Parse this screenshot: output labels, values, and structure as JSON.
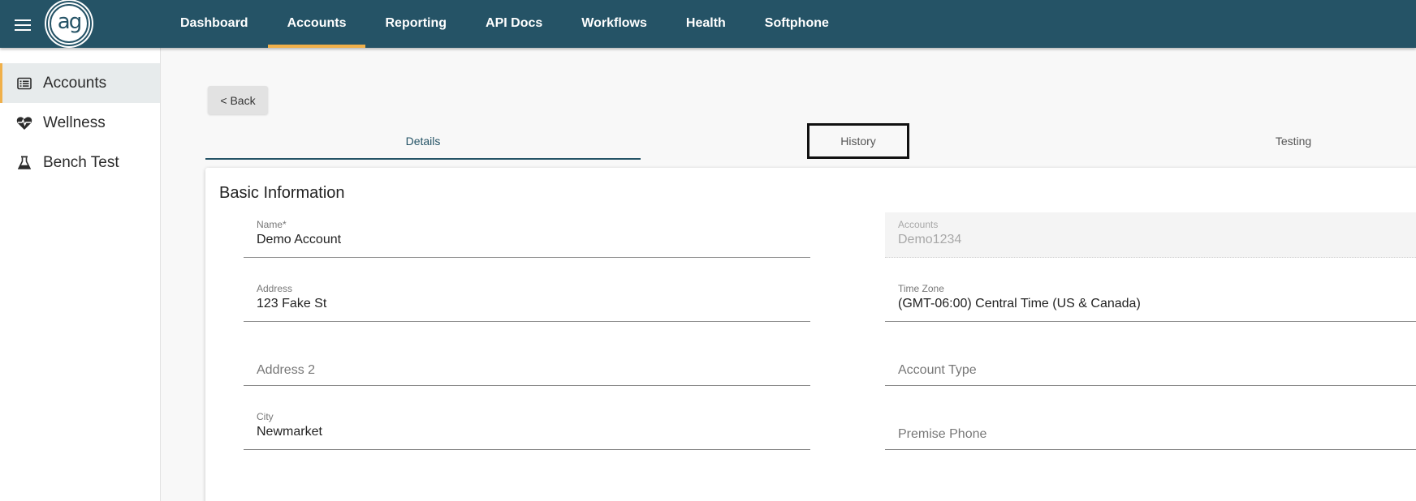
{
  "nav": {
    "items": [
      "Dashboard",
      "Accounts",
      "Reporting",
      "API Docs",
      "Workflows",
      "Health",
      "Softphone"
    ],
    "active": "Accounts",
    "logo_text": "ag"
  },
  "sidebar": {
    "items": [
      {
        "label": "Accounts",
        "icon": "list-icon"
      },
      {
        "label": "Wellness",
        "icon": "heart-pulse-icon"
      },
      {
        "label": "Bench Test",
        "icon": "flask-icon"
      }
    ]
  },
  "main": {
    "back_label": "< Back",
    "tabs": [
      "Details",
      "History",
      "Testing"
    ],
    "card_title": "Basic Information",
    "fields": {
      "name": {
        "label": "Name*",
        "value": "Demo Account"
      },
      "accounts": {
        "label": "Accounts",
        "value": "Demo1234"
      },
      "address": {
        "label": "Address",
        "value": "123 Fake St"
      },
      "time_zone": {
        "label": "Time Zone",
        "value": "(GMT-06:00) Central Time (US & Canada)"
      },
      "address2": {
        "placeholder": "Address 2"
      },
      "account_type": {
        "placeholder": "Account Type"
      },
      "city": {
        "label": "City",
        "value": "Newmarket"
      },
      "premise_phone": {
        "placeholder": "Premise Phone"
      }
    }
  },
  "colors": {
    "topbar": "#255366",
    "accent": "#f0b04a"
  }
}
